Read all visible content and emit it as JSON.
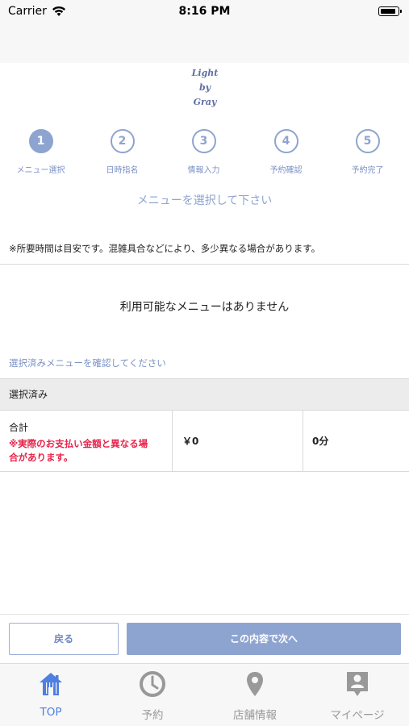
{
  "status_bar": {
    "carrier": "Carrier",
    "time": "8:16 PM"
  },
  "logo": {
    "line1": "Light",
    "line2": "by",
    "line3": "Gray"
  },
  "steps": [
    {
      "number": "1",
      "label": "メニュー選択",
      "active": true
    },
    {
      "number": "2",
      "label": "日時指名",
      "active": false
    },
    {
      "number": "3",
      "label": "情報入力",
      "active": false
    },
    {
      "number": "4",
      "label": "予約確認",
      "active": false
    },
    {
      "number": "5",
      "label": "予約完了",
      "active": false
    }
  ],
  "select_prompt": "メニューを選択して下さい",
  "note": "※所要時間は目安です。混雑具合などにより、多少異なる場合があります。",
  "empty_message": "利用可能なメニューはありません",
  "confirm_link": "選択済みメニューを確認してください",
  "selected_header": "選択済み",
  "total": {
    "label": "合計",
    "warning_line1": "※実際のお支払い金額と異なる場",
    "warning_line2": "合があります。",
    "price": "￥0",
    "duration": "0分"
  },
  "buttons": {
    "back": "戻る",
    "next": "この内容で次へ"
  },
  "tabs": [
    {
      "label": "TOP",
      "icon": "home-icon",
      "active": true
    },
    {
      "label": "予約",
      "icon": "clock-icon",
      "active": false
    },
    {
      "label": "店舗情報",
      "icon": "location-pin-icon",
      "active": false
    },
    {
      "label": "マイページ",
      "icon": "person-badge-icon",
      "active": false
    }
  ],
  "colors": {
    "accent": "#8ea4d0",
    "tab_active": "#4f7fe0",
    "warning": "#e8234a",
    "tab_inactive": "#999999"
  }
}
